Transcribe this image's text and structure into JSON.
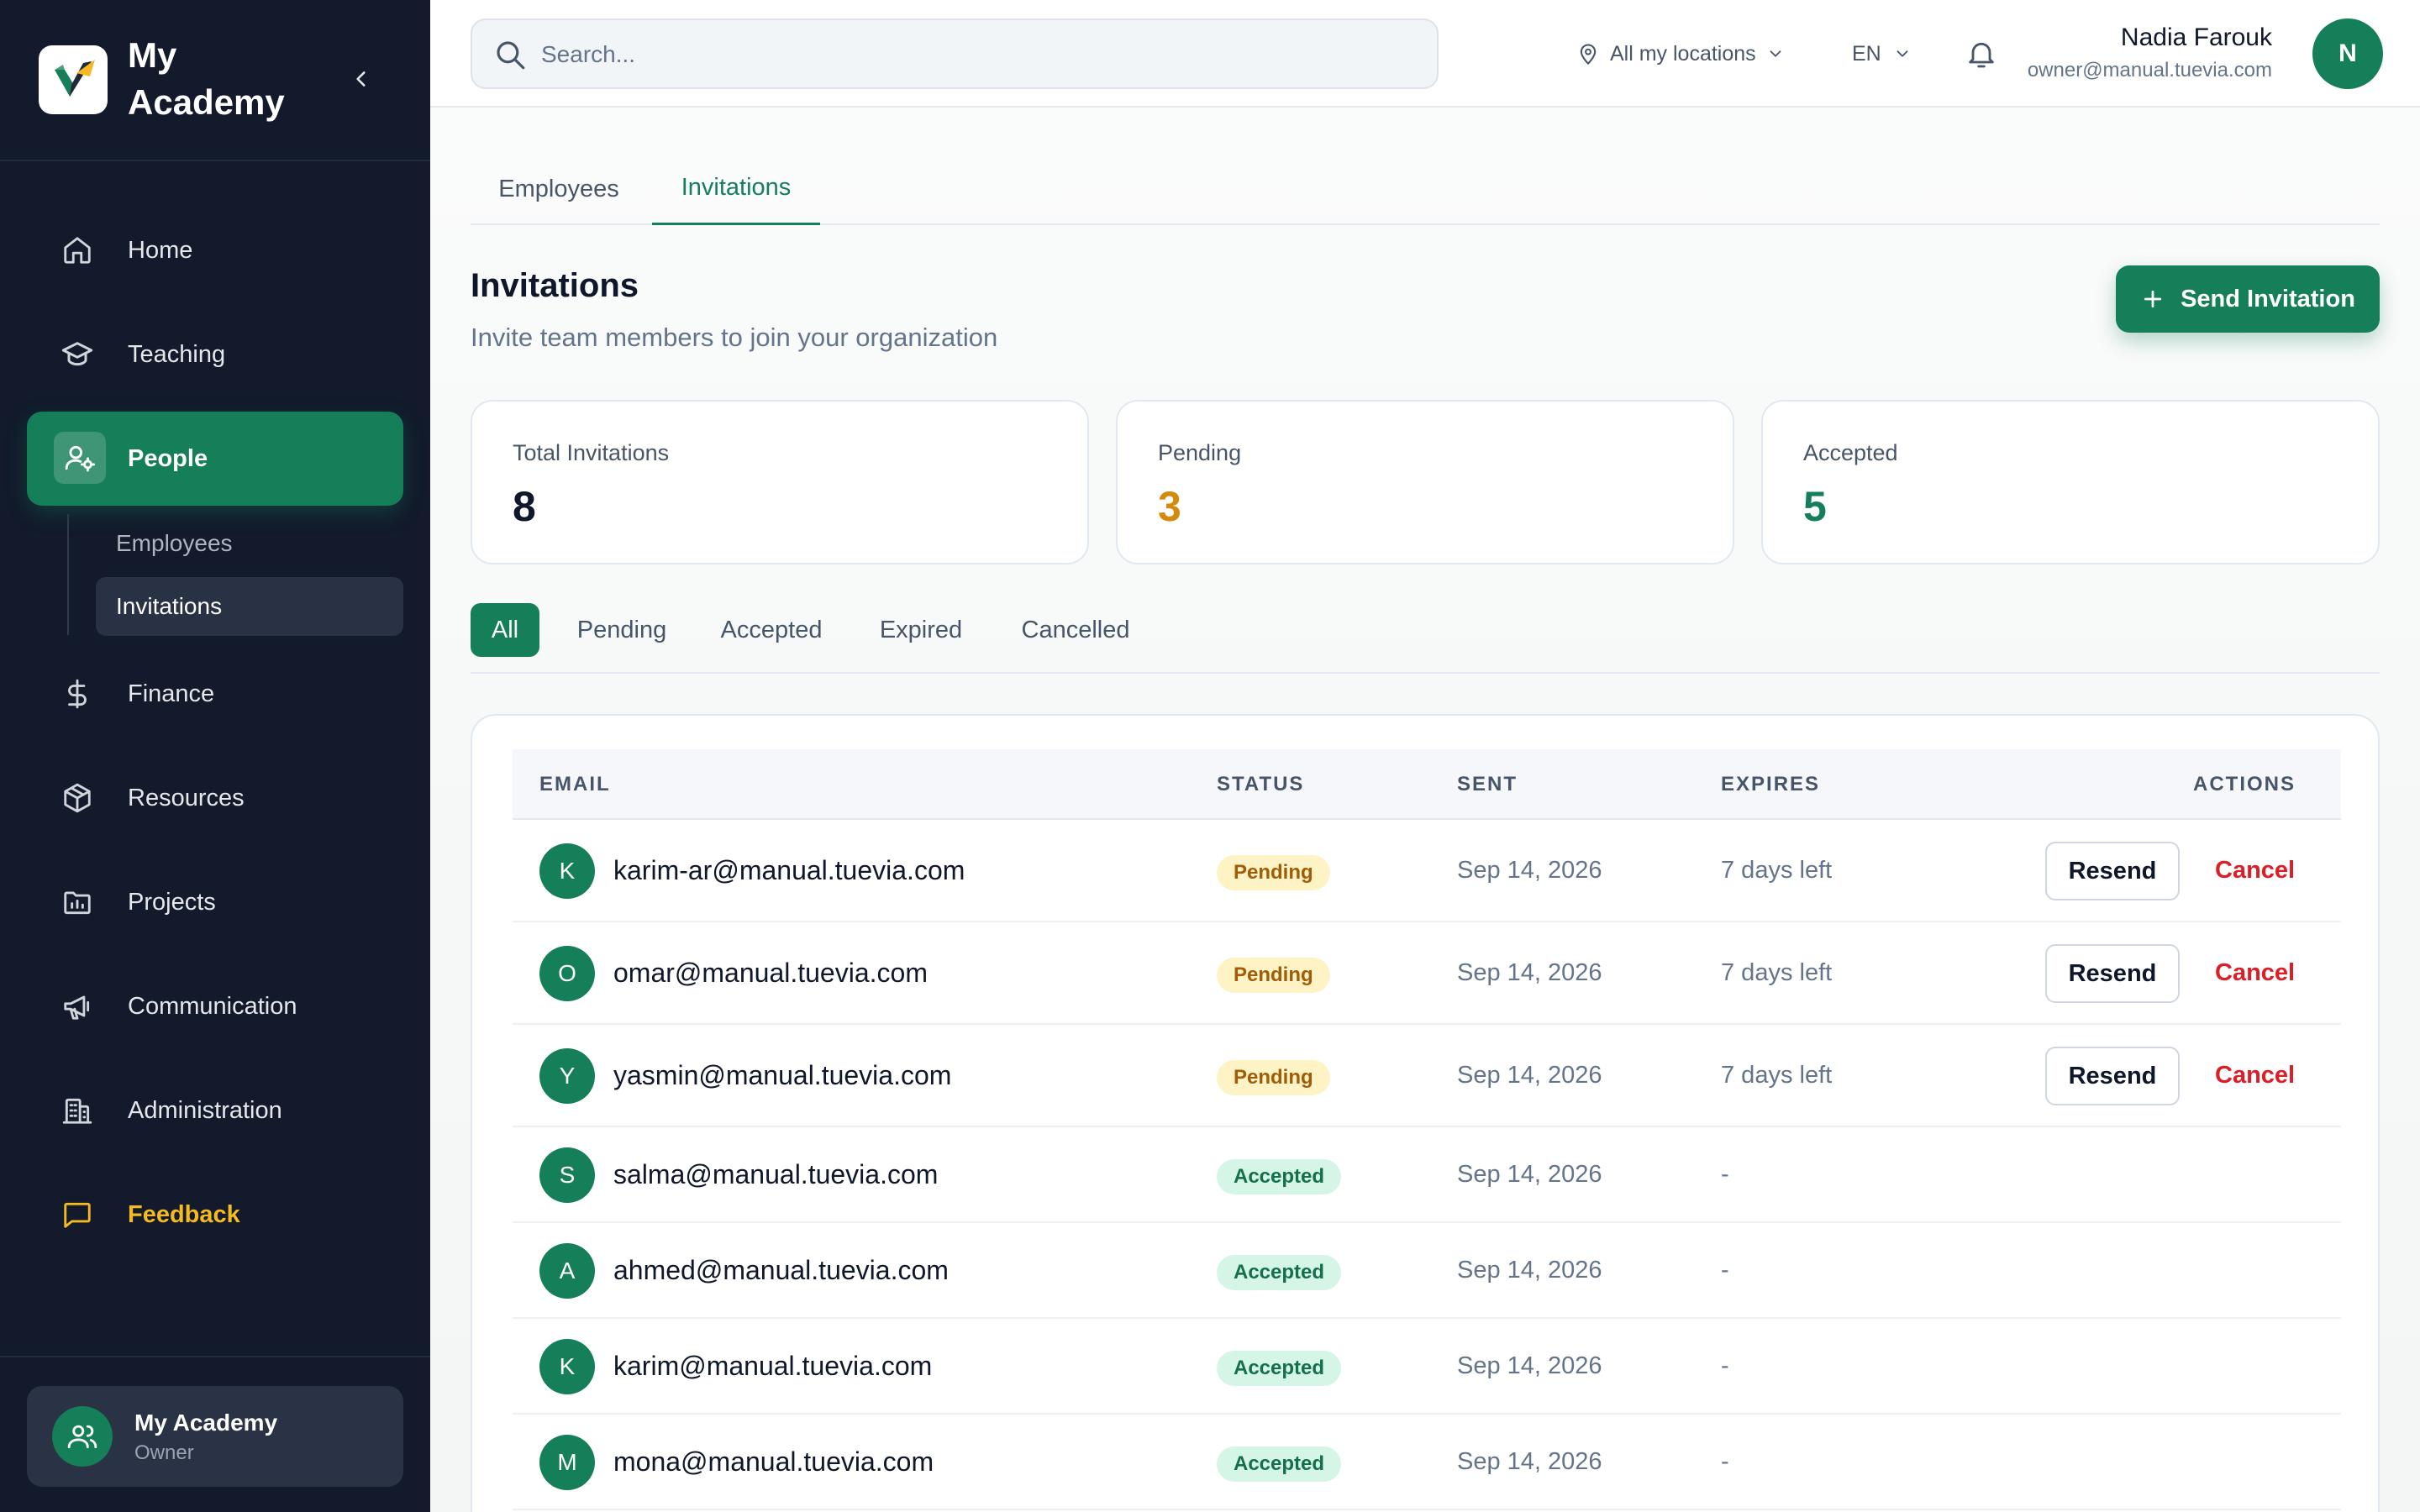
{
  "sidebar": {
    "brand": "My Academy",
    "nav": [
      {
        "label": "Home",
        "icon": "home-icon"
      },
      {
        "label": "Teaching",
        "icon": "graduation-cap-icon"
      },
      {
        "label": "People",
        "icon": "user-cog-icon"
      },
      {
        "label": "Finance",
        "icon": "dollar-icon"
      },
      {
        "label": "Resources",
        "icon": "package-icon"
      },
      {
        "label": "Projects",
        "icon": "folder-chart-icon"
      },
      {
        "label": "Communication",
        "icon": "megaphone-icon"
      },
      {
        "label": "Administration",
        "icon": "building-icon"
      },
      {
        "label": "Feedback",
        "icon": "message-square-icon"
      }
    ],
    "people_sub": [
      {
        "label": "Employees"
      },
      {
        "label": "Invitations"
      }
    ],
    "org": {
      "name": "My Academy",
      "role": "Owner"
    }
  },
  "topbar": {
    "search_placeholder": "Search...",
    "location": "All my locations",
    "language": "EN",
    "user_name": "Nadia Farouk",
    "user_email": "owner@manual.tuevia.com",
    "user_initial": "N"
  },
  "tabs": [
    {
      "label": "Employees"
    },
    {
      "label": "Invitations"
    }
  ],
  "header": {
    "title": "Invitations",
    "subtitle": "Invite team members to join your organization",
    "send_button": "Send Invitation"
  },
  "stats": [
    {
      "label": "Total Invitations",
      "value": "8",
      "color": "#0f172a"
    },
    {
      "label": "Pending",
      "value": "3",
      "color": "#d58a0b"
    },
    {
      "label": "Accepted",
      "value": "5",
      "color": "#157f59"
    }
  ],
  "filters": [
    {
      "label": "All"
    },
    {
      "label": "Pending"
    },
    {
      "label": "Accepted"
    },
    {
      "label": "Expired"
    },
    {
      "label": "Cancelled"
    }
  ],
  "table": {
    "columns": {
      "email": "EMAIL",
      "status": "STATUS",
      "sent": "SENT",
      "expires": "EXPIRES",
      "actions": "ACTIONS"
    },
    "rows": [
      {
        "initial": "K",
        "email": "karim-ar@manual.tuevia.com",
        "status": "Pending",
        "sent": "Sep 14, 2026",
        "expires": "7 days left",
        "resend": "Resend",
        "cancel": "Cancel"
      },
      {
        "initial": "O",
        "email": "omar@manual.tuevia.com",
        "status": "Pending",
        "sent": "Sep 14, 2026",
        "expires": "7 days left",
        "resend": "Resend",
        "cancel": "Cancel"
      },
      {
        "initial": "Y",
        "email": "yasmin@manual.tuevia.com",
        "status": "Pending",
        "sent": "Sep 14, 2026",
        "expires": "7 days left",
        "resend": "Resend",
        "cancel": "Cancel"
      },
      {
        "initial": "S",
        "email": "salma@manual.tuevia.com",
        "status": "Accepted",
        "sent": "Sep 14, 2026",
        "expires": "-"
      },
      {
        "initial": "A",
        "email": "ahmed@manual.tuevia.com",
        "status": "Accepted",
        "sent": "Sep 14, 2026",
        "expires": "-"
      },
      {
        "initial": "K",
        "email": "karim@manual.tuevia.com",
        "status": "Accepted",
        "sent": "Sep 14, 2026",
        "expires": "-"
      },
      {
        "initial": "M",
        "email": "mona@manual.tuevia.com",
        "status": "Accepted",
        "sent": "Sep 14, 2026",
        "expires": "-"
      }
    ]
  },
  "colors": {
    "accent": "#157f59",
    "sidebar": "#121a2b",
    "danger": "#dc1f26",
    "warning": "#d58a0b",
    "feedback": "#f5b921"
  }
}
